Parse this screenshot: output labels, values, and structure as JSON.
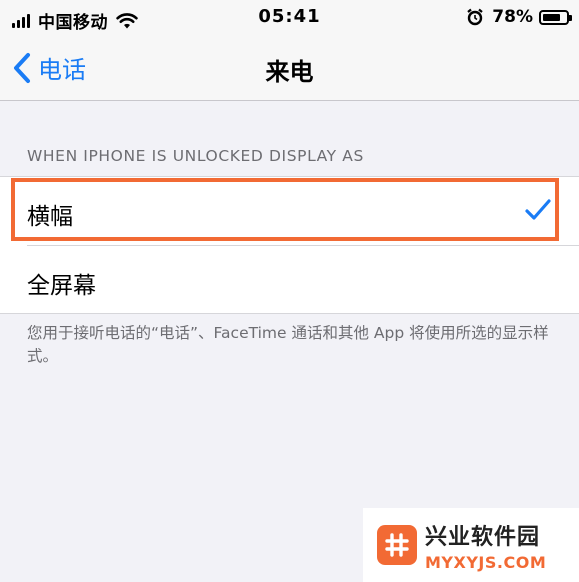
{
  "status_bar": {
    "carrier": "中国移动",
    "time": "05:41",
    "battery_percent": "78%",
    "battery_level": 0.78
  },
  "nav": {
    "back_label": "电话",
    "title": "来电"
  },
  "section": {
    "header": "WHEN IPHONE IS UNLOCKED DISPLAY AS",
    "options": [
      {
        "label": "横幅",
        "selected": true
      },
      {
        "label": "全屏幕",
        "selected": false
      }
    ],
    "footer": "您用于接听电话的“电话”、FaceTime 通话和其他 App 将使用所选的显示样式。"
  },
  "accent_color": "#1a7cf5",
  "highlight_color": "#f26a34",
  "watermark": {
    "title": "兴业软件园",
    "url": "MYXYJS.COM"
  }
}
